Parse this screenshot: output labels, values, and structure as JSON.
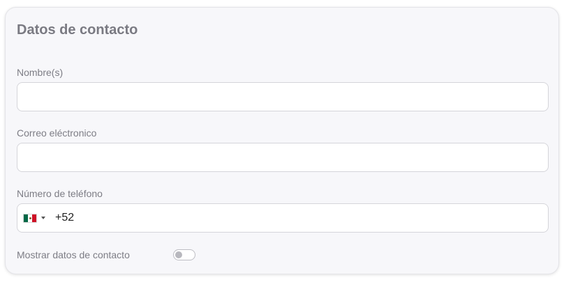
{
  "form": {
    "title": "Datos de contacto",
    "name": {
      "label": "Nombre(s)",
      "value": "",
      "placeholder": ""
    },
    "email": {
      "label": "Correo eléctronico",
      "value": "",
      "placeholder": ""
    },
    "phone": {
      "label": "Número de teléfono",
      "country_flag": "mexico-flag-icon",
      "dial_code": "+52",
      "value": ""
    },
    "show_contact": {
      "label": "Mostrar datos de contacto",
      "enabled": false
    }
  },
  "colors": {
    "card_background": "#f7f7fa",
    "title": "#7a7a82",
    "label": "#7d7d85",
    "input_border": "#d5d5da"
  }
}
